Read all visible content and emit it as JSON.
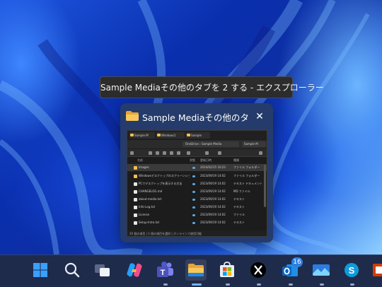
{
  "tooltip": {
    "text": "Sample Mediaその他のタブを 2 する - エクスプローラー"
  },
  "preview": {
    "title": "Sample Mediaその他のタ...",
    "close_glyph": "✕",
    "thumbnail": {
      "tabs": [
        "Sample M",
        "Windows1",
        "Sample"
      ],
      "address": [
        "OneDrive",
        "›",
        "Sample Media"
      ],
      "search_placeholder": "Sample M",
      "headers": [
        "名前",
        "状態",
        "更新日時",
        "種類"
      ],
      "rows": [
        {
          "name": "Images",
          "date": "2024/02/15 10:23",
          "type": "ファイル フォルダー",
          "kind": "folder"
        },
        {
          "name": "Windowsデスクトップのスクリーンショット",
          "date": "2023/09/19 14:02",
          "type": "ファイル フォルダー",
          "kind": "folder"
        },
        {
          "name": "PCでデスクトップを表示する方法",
          "date": "2023/09/19 14:02",
          "type": "テキスト ドキュメント",
          "kind": "doc"
        },
        {
          "name": "CHANGELOG.md",
          "date": "2023/09/19 14:02",
          "type": "MD ファイル",
          "kind": "doc"
        },
        {
          "name": "about-media.txt",
          "date": "2023/09/19 14:02",
          "type": "テキスト",
          "kind": "doc"
        },
        {
          "name": "Info-Log.txt",
          "date": "2023/09/19 14:02",
          "type": "テキスト",
          "kind": "doc"
        },
        {
          "name": "License",
          "date": "2023/09/19 14:02",
          "type": "ファイル",
          "kind": "doc"
        },
        {
          "name": "Setup-Intro.txt",
          "date": "2023/09/19 14:02",
          "type": "テキスト",
          "kind": "doc"
        }
      ],
      "status": "20 個の項目 | 1 個の項目を選択 | オンラインで使用可能"
    }
  },
  "taskbar": {
    "items": [
      {
        "name": "start-button",
        "icon": "windows-logo-icon",
        "running": false
      },
      {
        "name": "search-button",
        "icon": "search-icon",
        "running": false
      },
      {
        "name": "task-view-button",
        "icon": "task-view-icon",
        "running": false
      },
      {
        "name": "copilot-button",
        "icon": "copilot-icon",
        "running": false
      },
      {
        "name": "teams-button",
        "icon": "teams-icon",
        "running": true
      },
      {
        "name": "file-explorer-button",
        "icon": "folder-icon",
        "running": true,
        "active": true
      },
      {
        "name": "microsoft-store-button",
        "icon": "store-icon",
        "running": true
      },
      {
        "name": "x-button",
        "icon": "x-logo-icon",
        "running": true
      },
      {
        "name": "outlook-button",
        "icon": "outlook-icon",
        "running": true,
        "badge": "16"
      },
      {
        "name": "photos-button",
        "icon": "photos-icon",
        "running": true
      },
      {
        "name": "skype-button",
        "icon": "skype-icon",
        "running": true
      },
      {
        "name": "office-button",
        "icon": "office-icon",
        "running": false
      }
    ]
  },
  "colors": {
    "accent": "#0078d4",
    "folder": "#f2c04d",
    "tooltip_bg": "#2c2c2c",
    "taskbar_bg": "#1f2b4a"
  }
}
